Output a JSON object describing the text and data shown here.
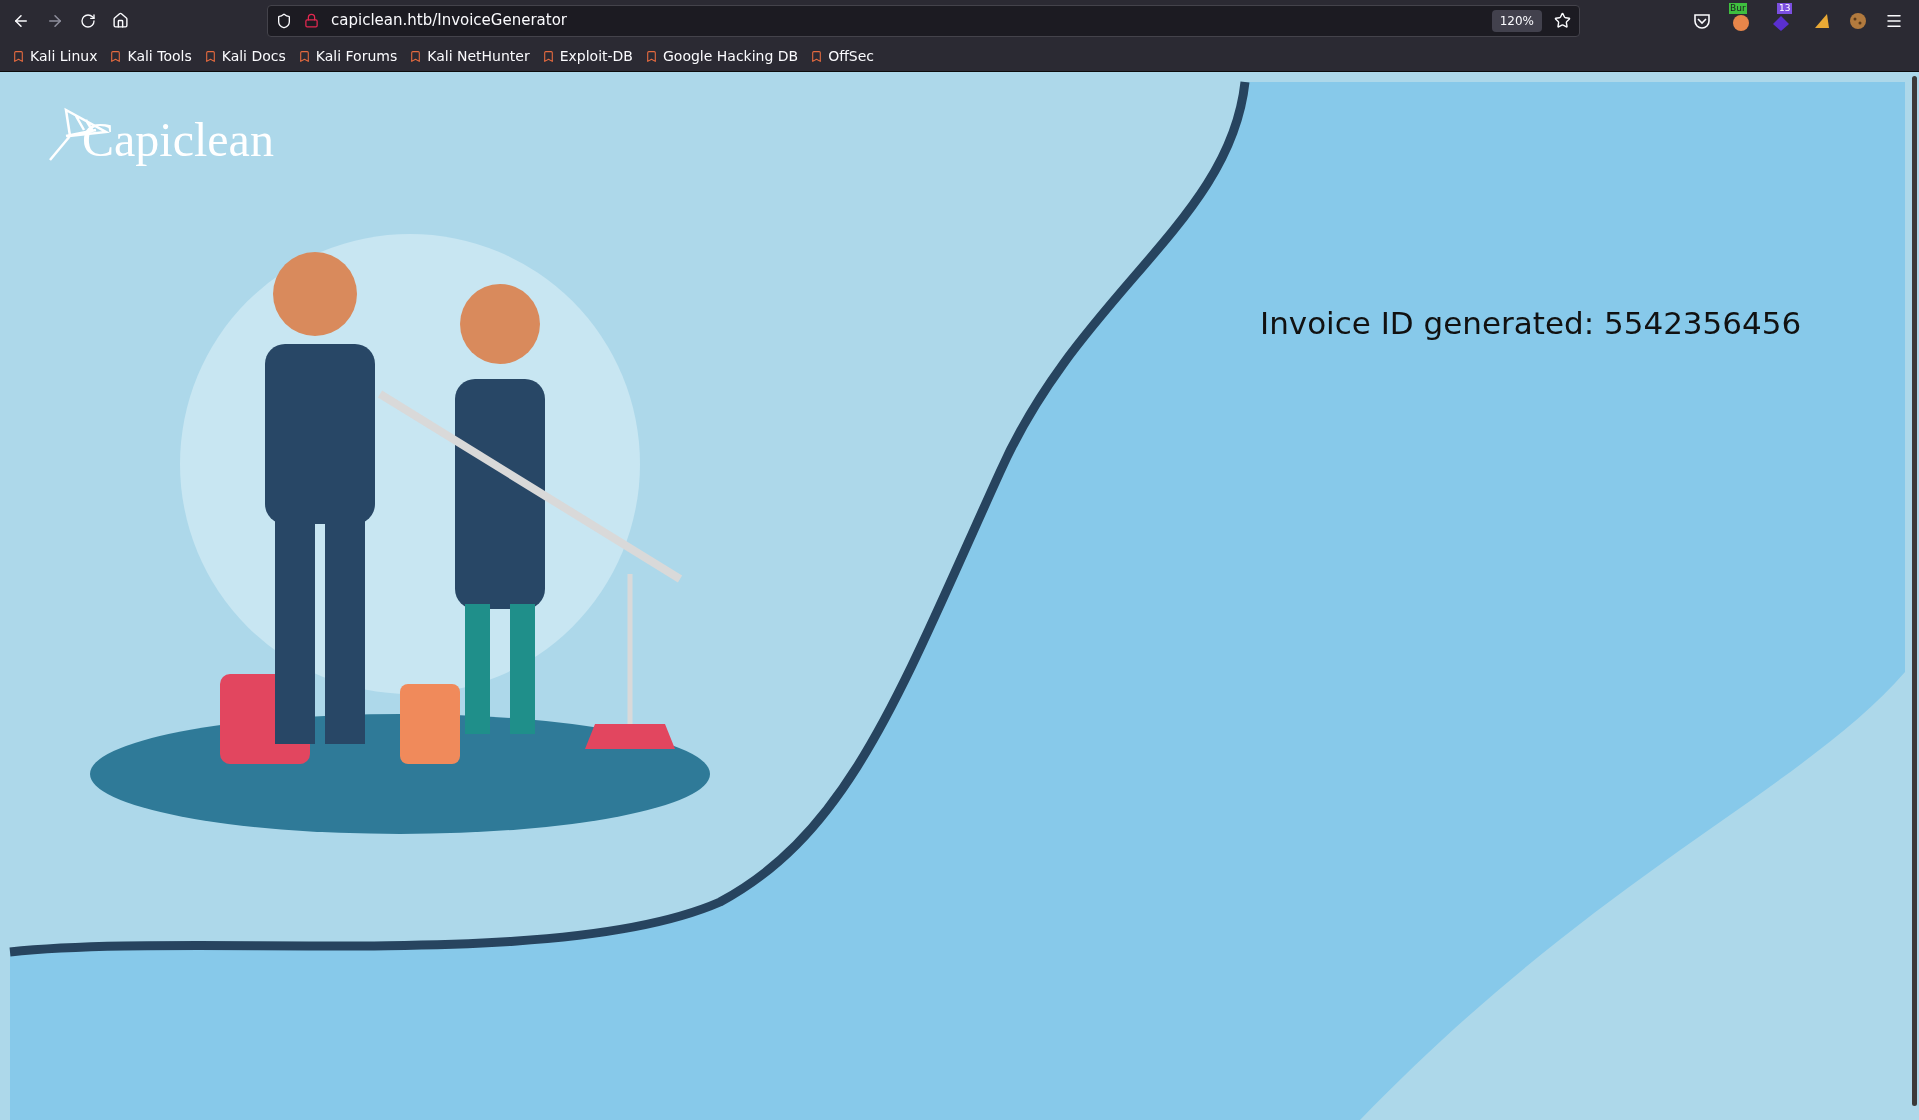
{
  "browser": {
    "url": "capiclean.htb/InvoiceGenerator",
    "zoom": "120%",
    "extension_badges": [
      "Bur",
      "13"
    ],
    "bookmarks": [
      "Kali Linux",
      "Kali Tools",
      "Kali Docs",
      "Kali Forums",
      "Kali NetHunter",
      "Exploit-DB",
      "Google Hacking DB",
      "OffSec"
    ]
  },
  "page": {
    "logo": "Capiclean",
    "message": "Invoice ID generated: 5542356456"
  }
}
